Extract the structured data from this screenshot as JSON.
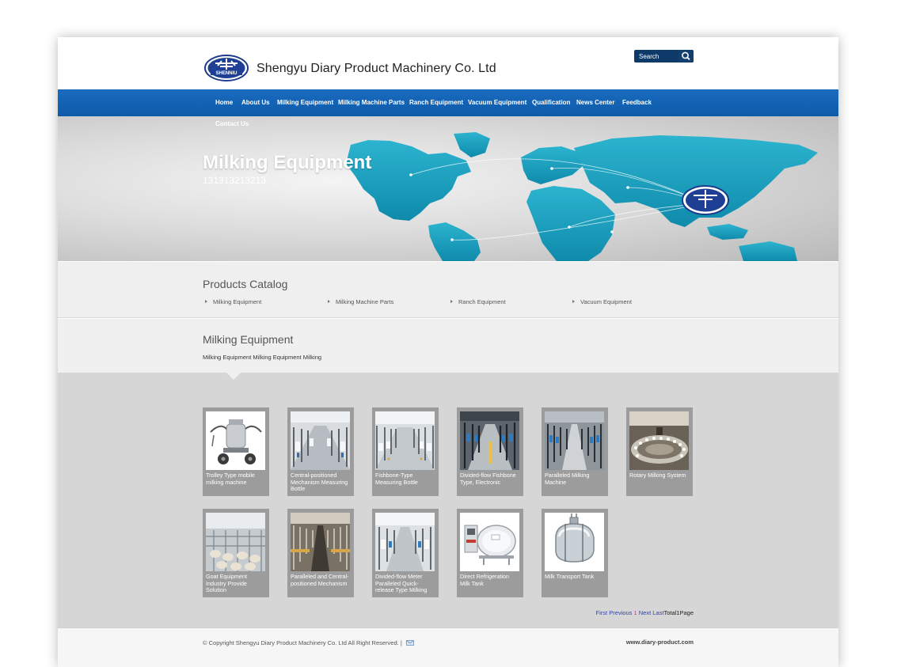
{
  "header": {
    "company_name": "Shengyu Diary Product Machinery Co. Ltd",
    "logo_text": "SHENNIU",
    "search_placeholder": "Search"
  },
  "nav": {
    "items": [
      {
        "label": "Home"
      },
      {
        "label": "About Us"
      },
      {
        "label": "Milking Equipment"
      },
      {
        "label": "Milking Machine Parts"
      },
      {
        "label": "Ranch Equipment"
      },
      {
        "label": "Vacuum Equipment"
      },
      {
        "label": "Qualification"
      },
      {
        "label": "News Center"
      },
      {
        "label": "Feedback"
      },
      {
        "label": "Contact Us"
      }
    ]
  },
  "banner": {
    "title": "Milking Equipment",
    "subtitle": "131313213213"
  },
  "catalog": {
    "title": "Products Catalog",
    "items": [
      {
        "label": "Milking Equipment"
      },
      {
        "label": "Milking Machine Parts"
      },
      {
        "label": "Ranch Equipment"
      },
      {
        "label": "Vacuum Equipment"
      }
    ]
  },
  "section": {
    "title": "Milking Equipment",
    "breadcrumb": "Milking Equipment Milking Equipment Milking"
  },
  "products": [
    {
      "caption": "Trolley Type mobile milking machine"
    },
    {
      "caption": "Central-positioned Mechanism Measuring Bottle"
    },
    {
      "caption": "Fishbone-Type Measuring Bottle"
    },
    {
      "caption": "Divided-flow Fishbone Type, Electronic"
    },
    {
      "caption": "Paralleled Milking Machine"
    },
    {
      "caption": "Rotary Milking System"
    },
    {
      "caption": "Goat Equipment Industry Provide Solution"
    },
    {
      "caption": "Paralleled and Central-positioned Mechanism"
    },
    {
      "caption": "Divided-flow Meter Paralleled Quick-release Type Milking"
    },
    {
      "caption": "Direct Refrigeration Milk Tank"
    },
    {
      "caption": "Milk Transport Tank"
    }
  ],
  "pagination": {
    "first": "First",
    "previous": "Previous",
    "current": "1",
    "next": "Next",
    "last": "Last",
    "total": "Total1Page"
  },
  "footer": {
    "copyright": "© Copyright Shengyu Diary Product Machinery Co. Ltd All Right Reserved.",
    "separator": "|",
    "domain": "www.diary-product.com"
  },
  "colors": {
    "nav_blue": "#0d5aa8",
    "map_teal": "#1597b6",
    "search_navy": "#0e3a6a",
    "card_gray": "#9c9c9c"
  }
}
